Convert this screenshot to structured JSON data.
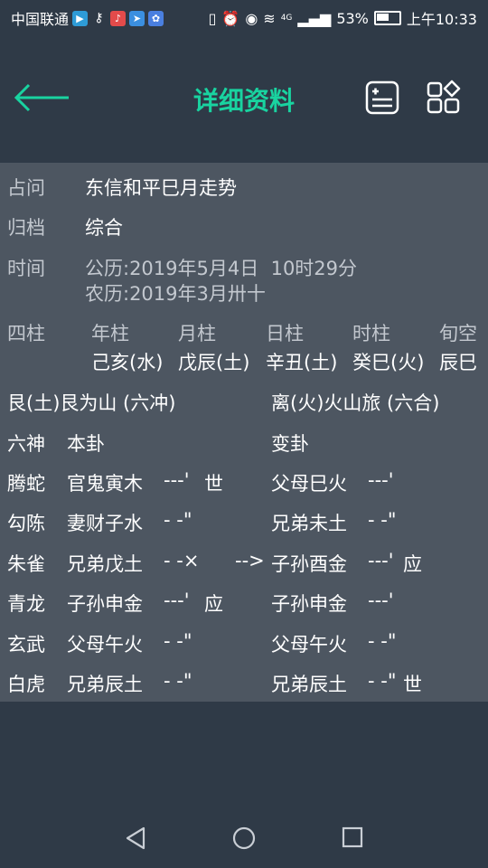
{
  "status": {
    "carrier": "中国联通",
    "battery": "53%",
    "time": "上午10:33",
    "net": "4G"
  },
  "header": {
    "title": "详细资料"
  },
  "detail": {
    "zhanwen_label": "占问",
    "zhanwen_value": "东信和平巳月走势",
    "guidang_label": "归档",
    "guidang_value": "综合",
    "time_label": "时间",
    "gongli": "公历:2019年5月4日  10时29分",
    "nongli": "农历:2019年3月卅十"
  },
  "pillars": {
    "label": "四柱",
    "headers": [
      "年柱",
      "月柱",
      "日柱",
      "时柱",
      "旬空"
    ],
    "values": [
      "己亥(水)",
      "戊辰(土)",
      "辛丑(土)",
      "癸巳(火)",
      "辰巳"
    ]
  },
  "gua": {
    "ben_name": "艮(土)艮为山 (六冲)",
    "bian_name": "离(火)火山旅 (六合)",
    "col_liushen": "六神",
    "col_bengua": "本卦",
    "col_biangua": "变卦",
    "lines": [
      {
        "shen": "腾蛇",
        "ben": "官鬼寅木",
        "ben_yao": "---'",
        "ben_mark": "世",
        "arrow": "",
        "bian": "父母巳火",
        "bian_yao": "---'",
        "bian_mark": ""
      },
      {
        "shen": "勾陈",
        "ben": "妻财子水",
        "ben_yao": "- -\"",
        "ben_mark": "",
        "arrow": "",
        "bian": "兄弟未土",
        "bian_yao": "- -\"",
        "bian_mark": ""
      },
      {
        "shen": "朱雀",
        "ben": "兄弟戊土",
        "ben_yao": "- -×",
        "ben_mark": "",
        "arrow": "-->",
        "bian": "子孙酉金",
        "bian_yao": "---'",
        "bian_mark": "应"
      },
      {
        "shen": "青龙",
        "ben": "子孙申金",
        "ben_yao": "---'",
        "ben_mark": "应",
        "arrow": "",
        "bian": "子孙申金",
        "bian_yao": "---'",
        "bian_mark": ""
      },
      {
        "shen": "玄武",
        "ben": "父母午火",
        "ben_yao": "- -\"",
        "ben_mark": "",
        "arrow": "",
        "bian": "父母午火",
        "bian_yao": "- -\"",
        "bian_mark": ""
      },
      {
        "shen": "白虎",
        "ben": "兄弟辰土",
        "ben_yao": "- -\"",
        "ben_mark": "",
        "arrow": "",
        "bian": "兄弟辰土",
        "bian_yao": "- -\"",
        "bian_mark": "世"
      }
    ]
  },
  "colors": {
    "accent": "#19d3a0",
    "background": "#2f3a47",
    "panel": "#4d5661"
  }
}
